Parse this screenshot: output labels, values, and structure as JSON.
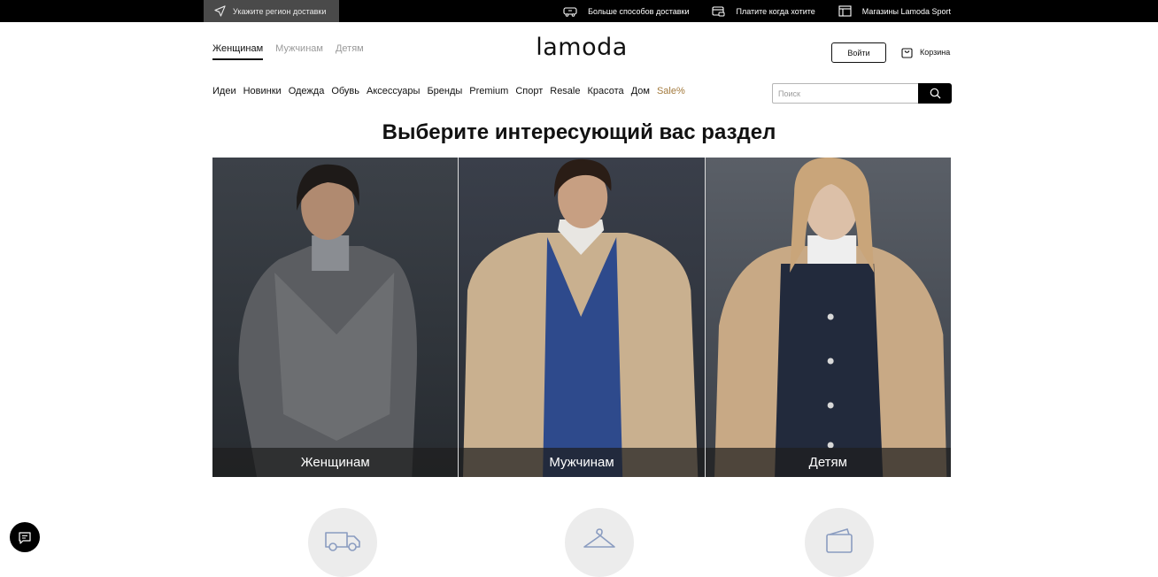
{
  "topbar": {
    "region_label": "Укажите регион доставки",
    "links": [
      {
        "label": "Больше способов доставки",
        "icon": "truck-icon"
      },
      {
        "label": "Платите когда хотите",
        "icon": "payment-card-icon"
      },
      {
        "label": "Магазины Lamoda Sport",
        "icon": "store-icon"
      }
    ]
  },
  "header": {
    "gender_tabs": [
      "Женщинам",
      "Мужчинам",
      "Детям"
    ],
    "active_tab": "Женщинам",
    "logo": "lamoda",
    "login_label": "Войти",
    "cart_label": "Корзина"
  },
  "nav": {
    "items": [
      "Идеи",
      "Новинки",
      "Одежда",
      "Обувь",
      "Аксессуары",
      "Бренды",
      "Premium",
      "Спорт",
      "Resale",
      "Красота",
      "Дом",
      "Sale%"
    ],
    "sale_color": "#a37a3d"
  },
  "search": {
    "placeholder": "Поиск"
  },
  "main": {
    "title": "Выберите интересующий вас раздел",
    "cards": [
      {
        "label": "Женщинам"
      },
      {
        "label": "Мужчинам"
      },
      {
        "label": "Детям"
      }
    ]
  },
  "features": [
    {
      "icon": "delivery-van-icon"
    },
    {
      "icon": "hanger-icon"
    },
    {
      "icon": "wallet-icon"
    }
  ],
  "chat": {
    "icon": "chat-icon"
  }
}
